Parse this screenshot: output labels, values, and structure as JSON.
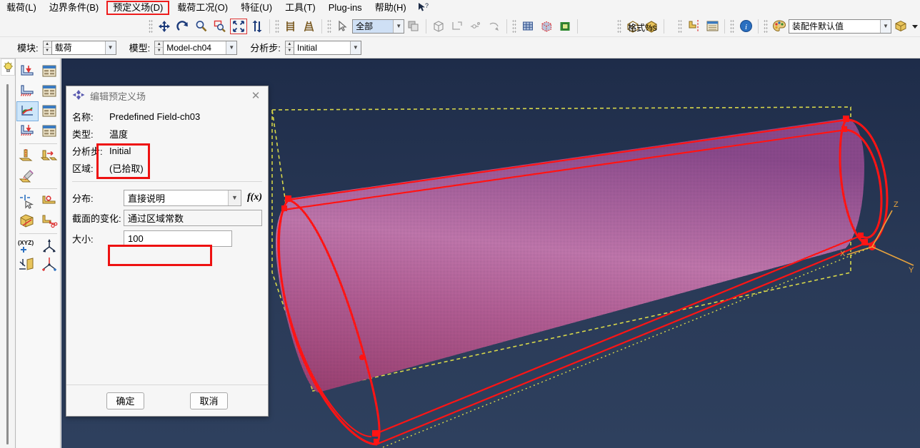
{
  "menu": {
    "items": [
      {
        "label": "载荷(L)",
        "mnemonic": "L",
        "highlighted": false
      },
      {
        "label": "边界条件(B)",
        "mnemonic": "B",
        "highlighted": false
      },
      {
        "label": "预定义场(D)",
        "mnemonic": "D",
        "highlighted": true
      },
      {
        "label": "载荷工况(O)",
        "mnemonic": "O",
        "highlighted": false
      },
      {
        "label": "特征(U)",
        "mnemonic": "U",
        "highlighted": false
      },
      {
        "label": "工具(T)",
        "mnemonic": "T",
        "highlighted": false
      },
      {
        "label": "Plug-ins",
        "mnemonic": "",
        "highlighted": false
      },
      {
        "label": "帮助(H)",
        "mnemonic": "H",
        "highlighted": false
      }
    ],
    "help_cursor_icon": "arrow-question-icon"
  },
  "toolbar": {
    "groups": [
      {
        "name": "view-manipulation",
        "icons": [
          "pan-icon",
          "rotate-icon",
          "zoom-in-icon",
          "zoom-box-icon",
          "fit-all-icon",
          "flip-view-icon"
        ]
      },
      {
        "name": "perspective",
        "icons": [
          "perspective-icon",
          "parallel-projection-icon"
        ]
      },
      {
        "name": "selection",
        "icons": [
          "select-arrow-icon"
        ]
      },
      {
        "name": "render",
        "icons": [
          "wireframe-icon",
          "hidden-line-icon",
          "shaded-icon"
        ]
      },
      {
        "name": "display-group",
        "icons": [
          "replace-group-icon",
          "copy-group-icon",
          "remove-group-icon"
        ]
      },
      {
        "name": "part-tools",
        "icons": [
          "part-cube-icon",
          "solid-cube-icon"
        ]
      },
      {
        "name": "query",
        "icons": [
          "datum-icon",
          "table-icon"
        ]
      },
      {
        "name": "info",
        "icons": [
          "info-icon"
        ]
      },
      {
        "name": "color",
        "icons": [
          "color-palette-icon"
        ]
      }
    ],
    "selection_filter": {
      "label": "全部",
      "name": "selection-filter-combo"
    },
    "overlay_text": "格式%s",
    "color_code_combo": {
      "value": "装配件默认值",
      "name": "color-code-combo"
    },
    "color_dropdown_icon": "cube-dropdown-icon"
  },
  "context_bar": {
    "module": {
      "label": "模块:",
      "value": "载荷"
    },
    "model": {
      "label": "模型:",
      "value": "Model-ch04"
    },
    "step": {
      "label": "分析步:",
      "value": "Initial"
    }
  },
  "left_rail": {
    "bulb_icon": "lightbulb-icon",
    "tools": [
      [
        "create-load-icon",
        "load-manager-icon"
      ],
      [
        "create-bc-icon",
        "bc-manager-icon"
      ],
      [
        "create-predefined-field-icon",
        "predefined-field-manager-icon"
      ],
      [
        "create-load-case-icon",
        "load-case-manager-icon"
      ],
      [
        "amplitude-icon",
        "move-load-icon"
      ],
      [
        "edit-amplitude-icon",
        null
      ],
      [
        "create-point-icon",
        "create-datum-axis-icon"
      ],
      [
        "partition-icon",
        "cut-icon"
      ],
      [
        "create-datum-point-icon",
        "create-datum-csys-icon"
      ],
      [
        "create-datum-plane-icon",
        "create-datum-axis-3pt-icon"
      ]
    ],
    "selected_index": 2,
    "xyz_label": "(XYZ)"
  },
  "dialog": {
    "title": "编辑预定义场",
    "title_icon": "predefined-field-icon",
    "close_icon": "close-icon",
    "fields": {
      "name": {
        "label": "名称:",
        "value": "Predefined Field-ch03"
      },
      "type": {
        "label": "类型:",
        "value": "温度"
      },
      "step": {
        "label": "分析步:",
        "value": "Initial"
      },
      "region": {
        "label": "区域:",
        "value": "(已拾取)"
      },
      "distribution": {
        "label": "分布:",
        "value": "直接说明",
        "fx_label": "f(x)"
      },
      "section_variation": {
        "label": "截面的变化:",
        "value": "通过区域常数"
      },
      "magnitude": {
        "label": "大小:",
        "value": "100"
      }
    },
    "buttons": {
      "ok": "确定",
      "cancel": "取消"
    },
    "highlights": [
      {
        "name": "type-step-highlight"
      },
      {
        "name": "magnitude-highlight"
      }
    ]
  },
  "viewport": {
    "name": "3d-model-viewport",
    "background_top": "#1e2c49",
    "background_bottom": "#2e405e",
    "model": {
      "name": "cylinder-shell-model",
      "surface_color": "#b06699",
      "edge_color": "#ff0000",
      "bbox_color": "#d8d84a"
    },
    "triad": {
      "name": "coordinate-triad",
      "color": "#e8a33d",
      "axes": [
        "X",
        "Y",
        "Z"
      ]
    }
  }
}
